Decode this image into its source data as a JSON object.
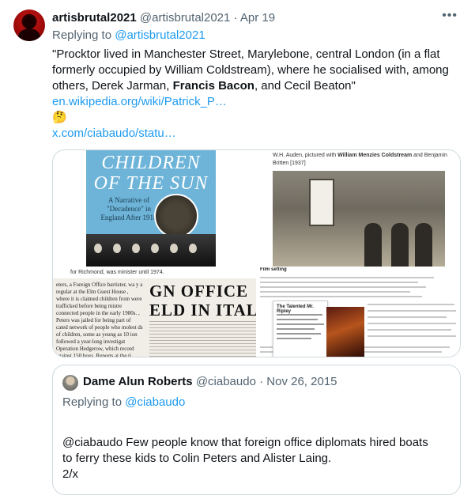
{
  "tweet": {
    "display_name": "artisbrutal2021",
    "handle": "@artisbrutal2021",
    "separator": "·",
    "date": "Apr 19",
    "more_icon": "more-horizontal-icon",
    "replying_prefix": "Replying to",
    "replying_handle": "@artisbrutal2021",
    "text_line1": "\"Procktor lived in Manchester Street, Marylebone, central London (in a flat",
    "text_line2": "formerly occupied by William Coldstream), where he socialised with, among",
    "text_line3a": "others, Derek Jarman, ",
    "text_line3b": "Francis Bacon",
    "text_line3c": ", and Cecil Beaton\"",
    "link1": "en.wikipedia.org/wiki/Patrick_P…",
    "emoji": "🤔",
    "link2": "x.com/ciabaudo/statu…"
  },
  "media": {
    "book_title": "CHILDREN OF THE SUN",
    "book_subtitle": "A Narrative of \"Decadence\" in England After 1918",
    "photo_caption_pre": "W.H. Auden, pictured with ",
    "photo_caption_bold": "William Menzies Coldstream",
    "photo_caption_post": " and Benjamin Britten [1937]",
    "newspaper_topline": "for Richmond, was minister until 1974.",
    "newspaper_headline1": "GN OFFICE",
    "newspaper_headline2": "ELD IN ITAL",
    "newspaper_col": "eters, a Foreign Office barrister, wa y a regular at the Elm Guest House , where it is claimed children from were trafficked before being mistre connected people in the early 1980s. , Peters was jailed for being part of cated network of people who molest ds of children, some as young as 10 ion followed a year-long investigat Operation Hedgerow, which record against 150 boys. Reports at the ti \"was used by highly placed civil se d-known public figures\", but police ve evidence or manpower to pursue",
    "wiki_heading": "Film setting",
    "wiki_popup_title": "The Talented Mr. Ripley"
  },
  "quote": {
    "avatar_icon": "user-avatar",
    "display_name": "Dame Alun Roberts",
    "handle": "@ciabaudo",
    "separator": "·",
    "date": "Nov 26, 2015",
    "replying_prefix": "Replying to",
    "replying_handle": "@ciabaudo",
    "text_line1": "@ciabaudo Few people know that foreign office diplomats hired boats",
    "text_line2": "to ferry these kids to Colin Peters and Alister Laing.",
    "text_line3": "2/x"
  },
  "colors": {
    "link": "#1d9bf0",
    "muted": "#536471",
    "text": "#0f1419",
    "border": "#cfd9de"
  }
}
